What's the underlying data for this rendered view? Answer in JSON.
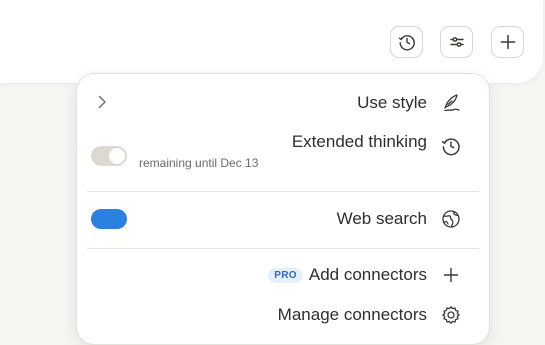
{
  "toolbar": {
    "buttons": [
      {
        "name": "history",
        "icon": "clock-icon"
      },
      {
        "name": "settings",
        "icon": "sliders-icon"
      },
      {
        "name": "add",
        "icon": "plus-icon"
      }
    ]
  },
  "menu": {
    "use_style": {
      "label": "Use style",
      "icon": "feather-pen-icon"
    },
    "extended_thinking": {
      "label": "Extended thinking",
      "sublabel": "remaining until Dec 13",
      "enabled": false,
      "icon": "clock-icon"
    },
    "web_search": {
      "label": "Web search",
      "enabled": true,
      "icon": "globe-icon"
    },
    "add_connectors": {
      "label": "Add connectors",
      "badge": "PRO",
      "icon": "plus-icon"
    },
    "manage_connectors": {
      "label": "Manage connectors",
      "icon": "gear-icon"
    }
  },
  "colors": {
    "toggle_on": "#2b80e0",
    "toggle_off": "#dcd9d2",
    "pro_badge_text": "#2b6cc4",
    "pro_badge_bg": "#e7effa"
  }
}
